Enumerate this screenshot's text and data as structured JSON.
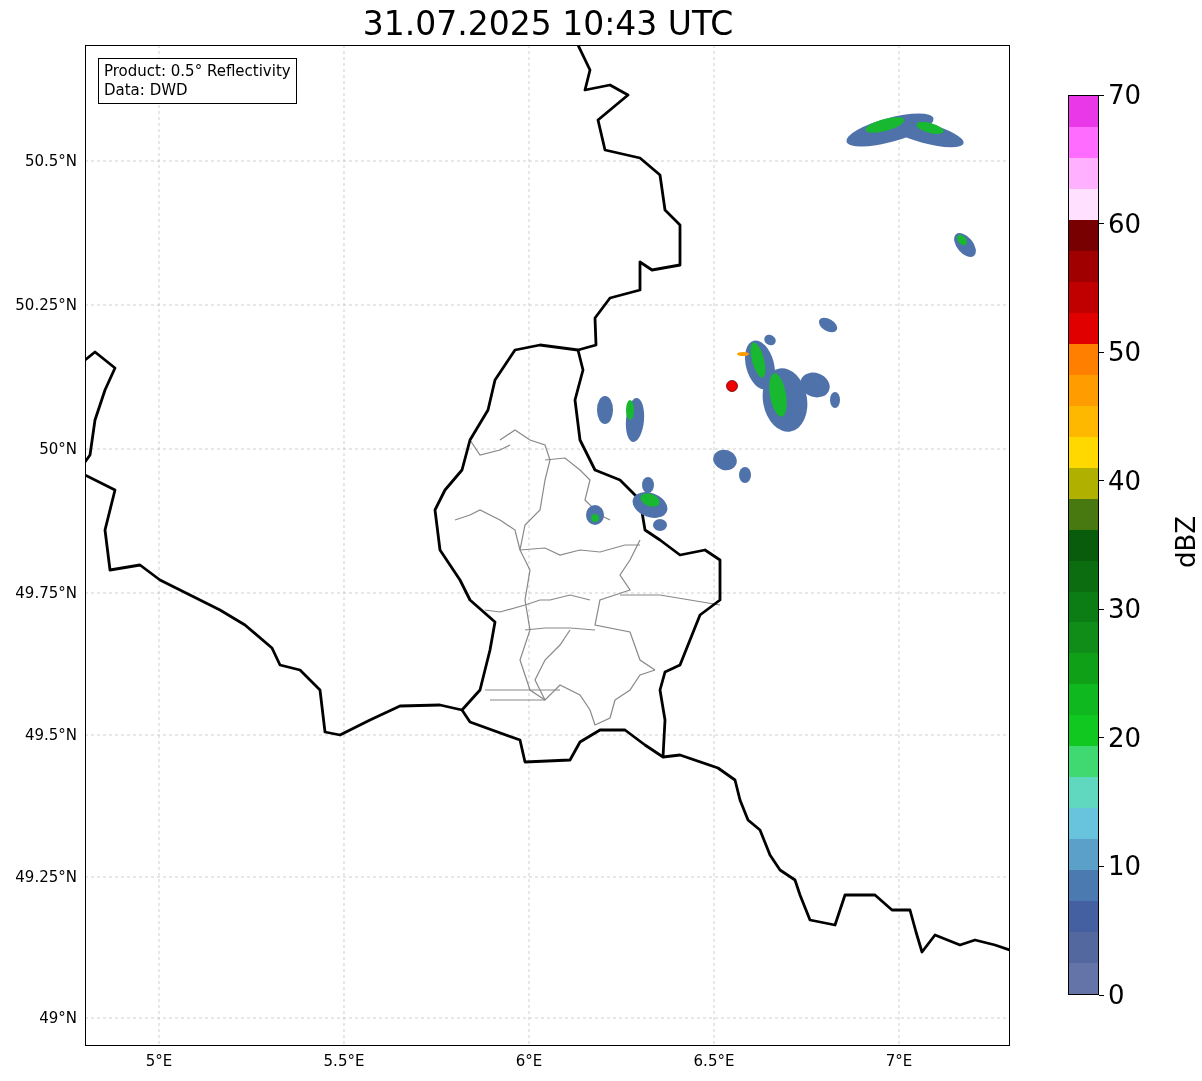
{
  "title": "31.07.2025 10:43 UTC",
  "legend": {
    "lines": [
      "Product: 0.5° Reflectivity",
      "Data: DWD"
    ]
  },
  "map": {
    "xticks": [
      "5°E",
      "5.5°E",
      "6°E",
      "6.5°E",
      "7°E"
    ],
    "yticks": [
      "50.5°N",
      "50.25°N",
      "50°N",
      "49.75°N",
      "49.5°N",
      "49.25°N",
      "49°N"
    ]
  },
  "colorbar": {
    "label": "dBZ",
    "ticks": [
      "70",
      "60",
      "50",
      "40",
      "30",
      "20",
      "10",
      "0"
    ],
    "segments": [
      {
        "color": "#e838e8"
      },
      {
        "color": "#ff6cff"
      },
      {
        "color": "#ffb0ff"
      },
      {
        "color": "#ffe0ff"
      },
      {
        "color": "#780000"
      },
      {
        "color": "#a00000"
      },
      {
        "color": "#c00000"
      },
      {
        "color": "#e00000"
      },
      {
        "color": "#ff8000"
      },
      {
        "color": "#ff9c00"
      },
      {
        "color": "#ffb800"
      },
      {
        "color": "#ffd800"
      },
      {
        "color": "#b0b000"
      },
      {
        "color": "#487810"
      },
      {
        "color": "#085c0c"
      },
      {
        "color": "#0c6c10"
      },
      {
        "color": "#0c7c14"
      },
      {
        "color": "#108c18"
      },
      {
        "color": "#10a018"
      },
      {
        "color": "#10b820"
      },
      {
        "color": "#10c820"
      },
      {
        "color": "#40d870"
      },
      {
        "color": "#60d8c0"
      },
      {
        "color": "#68c4dc"
      },
      {
        "color": "#5aa0c8"
      },
      {
        "color": "#4a7ab0"
      },
      {
        "color": "#4460a0"
      },
      {
        "color": "#5468a0"
      },
      {
        "color": "#6474a8"
      }
    ]
  }
}
